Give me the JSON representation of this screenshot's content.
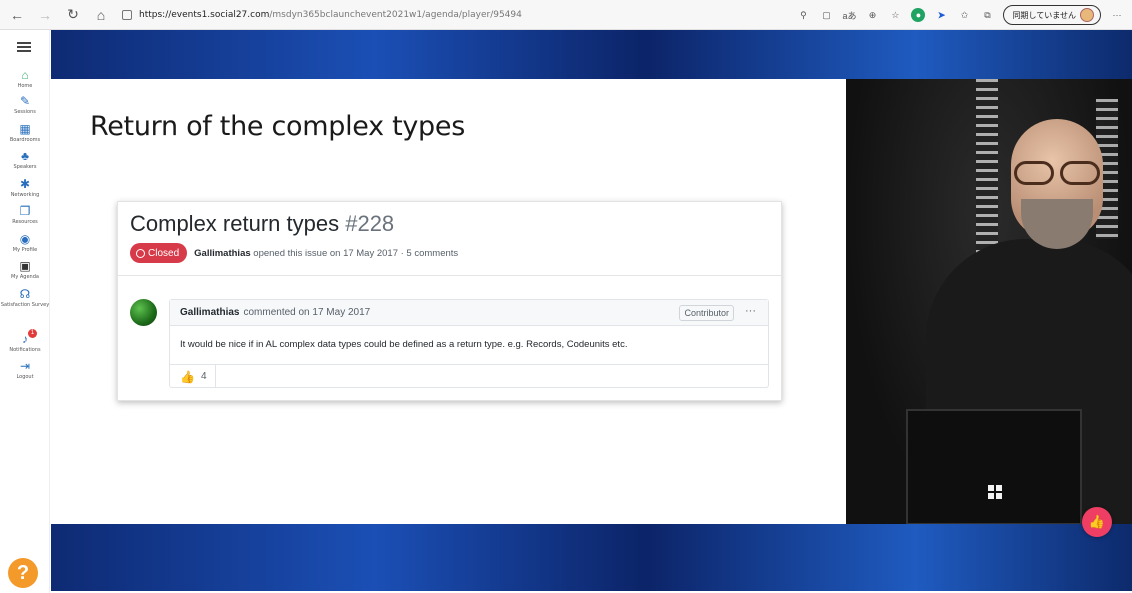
{
  "browser": {
    "back_icon": "←",
    "forward_icon": "→",
    "refresh_icon": "↻",
    "home_icon": "⌂",
    "url_host": "https://events1.social27.com",
    "url_path": "/msdyn365bclaunchevent2021w1/agenda/player/95494",
    "reader_icon": "aあ",
    "sync_label": "同期していません",
    "more_icon": "···"
  },
  "sidebar": {
    "items": [
      {
        "label": "Home",
        "icon": "home-icon"
      },
      {
        "label": "Sessions",
        "icon": "pen-icon"
      },
      {
        "label": "Boardrooms",
        "icon": "boardroom-icon"
      },
      {
        "label": "Speakers",
        "icon": "speaker-icon"
      },
      {
        "label": "Networking",
        "icon": "networking-icon"
      },
      {
        "label": "Resources",
        "icon": "resources-icon"
      },
      {
        "label": "My Profile",
        "icon": "profile-icon"
      },
      {
        "label": "My Agenda",
        "icon": "agenda-icon"
      },
      {
        "label": "Satisfaction Survey",
        "icon": "survey-icon"
      },
      {
        "label": "Notifications",
        "icon": "bell-icon",
        "badge": "1"
      },
      {
        "label": "Logout",
        "icon": "logout-icon"
      }
    ],
    "help_label": "?"
  },
  "slide": {
    "title": "Return of the complex types",
    "issue": {
      "title": "Complex return types",
      "number": "#228",
      "status": "Closed",
      "author": "Gallimathias",
      "meta": "opened this issue on 17 May 2017 · 5 comments",
      "comment": {
        "author": "Gallimathias",
        "date_text": "commented on 17 May 2017",
        "role": "Contributor",
        "menu": "···",
        "body": "It would be nice if in AL complex data types could be defined as a return type. e.g. Records, Codeunits etc.",
        "reaction_count": "4"
      }
    }
  },
  "video": {
    "like_icon": "thumbs-up-icon"
  },
  "colors": {
    "closed": "#d73a49",
    "accent_pink": "#ee3e63",
    "help_orange": "#f39a2a",
    "sidebar_icon": "#2a6fbd"
  }
}
